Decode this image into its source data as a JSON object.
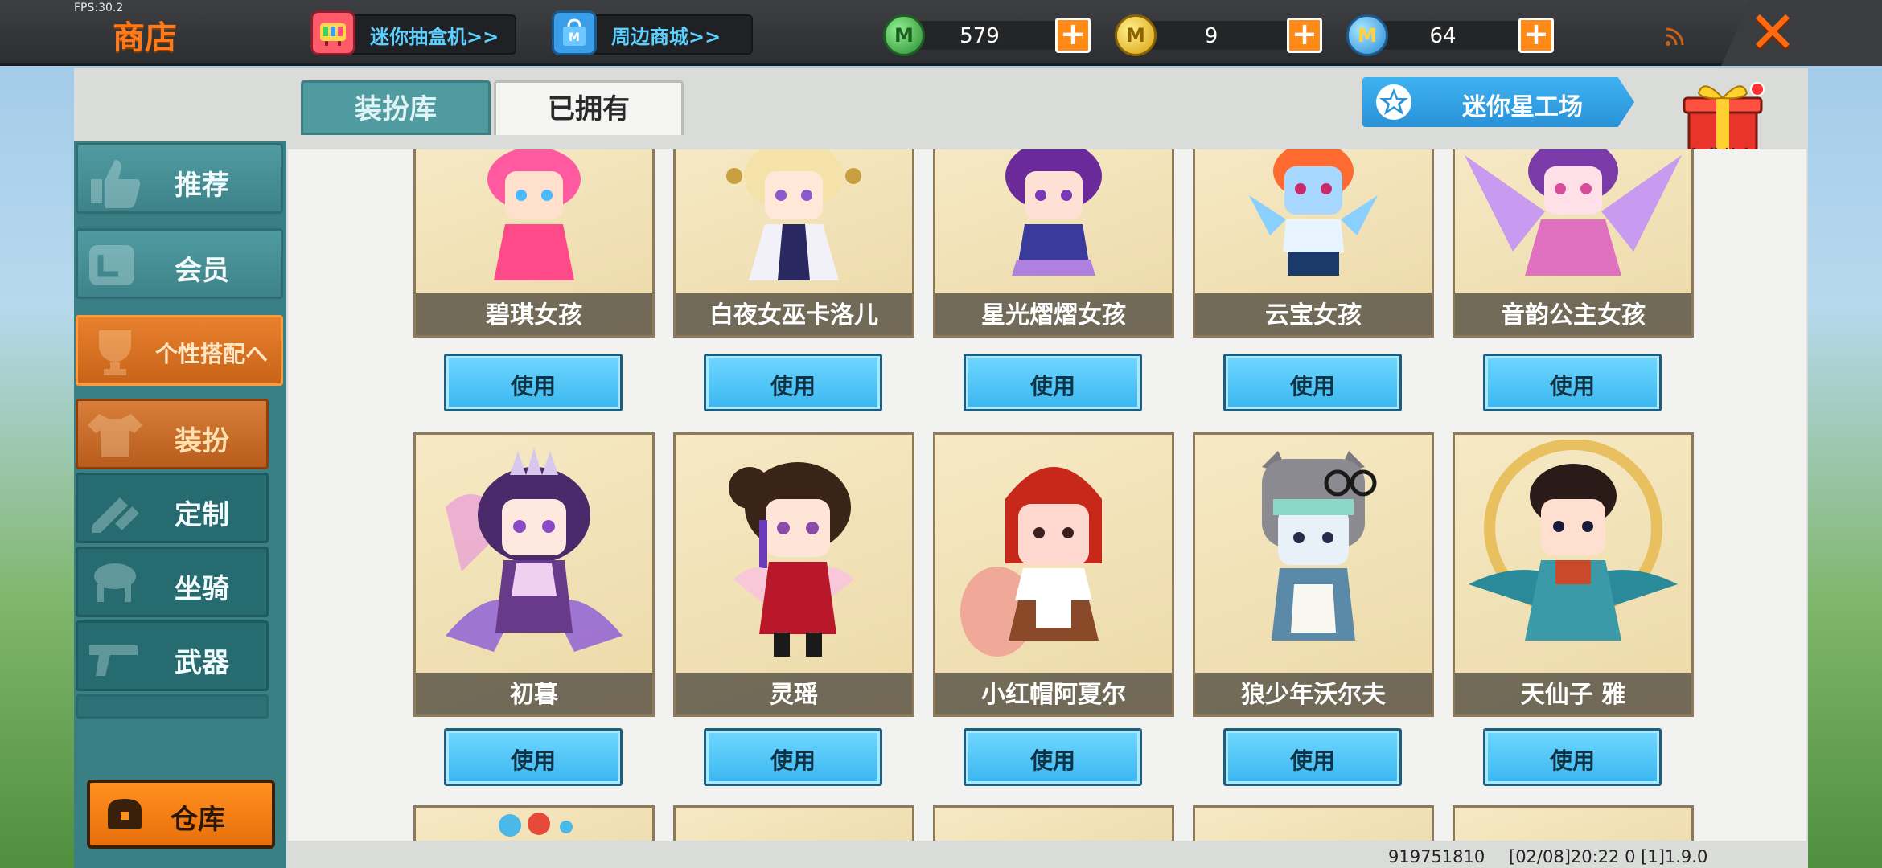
{
  "fps": "FPS:30.2",
  "header": {
    "title": "商店",
    "promo_blindbox": "迷你抽盒机>>",
    "promo_mall": "周边商城>>",
    "currencies": [
      {
        "icon": "green-gem-icon",
        "value": "579",
        "color": "#3aa845"
      },
      {
        "icon": "gold-m-coin-icon",
        "value": "9",
        "color": "#e8b820"
      },
      {
        "icon": "blue-m-coin-icon",
        "value": "64",
        "color": "#3aa0e8"
      }
    ]
  },
  "sidebar": {
    "items": [
      {
        "label": "推荐",
        "icon": "thumbs-up-icon"
      },
      {
        "label": "会员",
        "icon": "member-card-icon"
      },
      {
        "label": "个性搭配へ",
        "icon": "trophy-icon"
      },
      {
        "label": "装扮",
        "icon": "shirt-icon"
      },
      {
        "label": "定制",
        "icon": "pencil-ruler-icon"
      },
      {
        "label": "坐骑",
        "icon": "mount-icon"
      },
      {
        "label": "武器",
        "icon": "gun-icon"
      }
    ],
    "warehouse": "仓库"
  },
  "tabs": {
    "wardrobe": "装扮库",
    "owned": "已拥有"
  },
  "starworks": "迷你星工场",
  "gift": "免费礼包",
  "grid": {
    "use_label": "使用",
    "row1": [
      "碧琪女孩",
      "白夜女巫卡洛儿",
      "星光熠熠女孩",
      "云宝女孩",
      "音韵公主女孩"
    ],
    "row2": [
      "初暮",
      "灵瑶",
      "小红帽阿夏尔",
      "狼少年沃尔夫",
      "天仙子 雅"
    ]
  },
  "footer": {
    "uid": "919751810",
    "build": "[02/08]20:22 0 [1]1.9.0"
  },
  "colors": {
    "accent_orange": "#ff7a1a",
    "use_button": "#39b6f0",
    "sidebar_teal": "#3a7f84"
  }
}
